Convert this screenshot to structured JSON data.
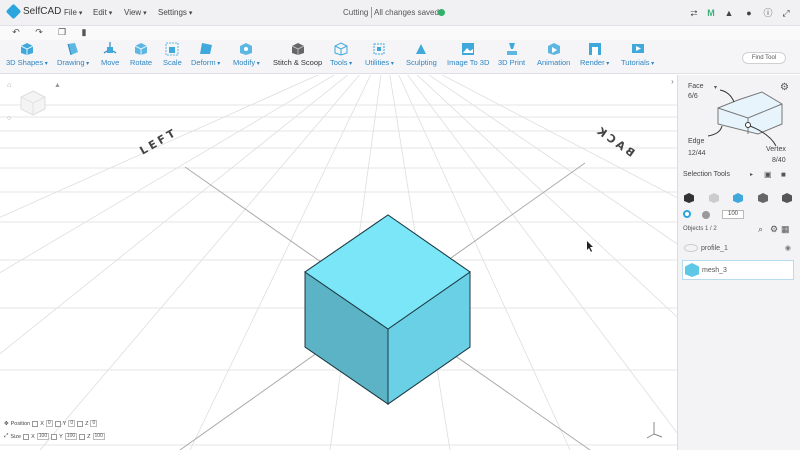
{
  "app": {
    "logo_text": "SelfCAD"
  },
  "menus": [
    "File",
    "Edit",
    "View",
    "Settings"
  ],
  "document": {
    "title": "Cutting",
    "status": "All changes saved"
  },
  "top_icons": [
    "share-icon",
    "m-icon",
    "bell-icon",
    "user-icon",
    "help-icon",
    "fullscreen-icon"
  ],
  "quick_icons": [
    "undo-icon",
    "redo-icon",
    "copy-icon",
    "paste-icon"
  ],
  "toolbar": {
    "tools": [
      {
        "label": "3D Shapes",
        "dropdown": true
      },
      {
        "label": "Drawing",
        "dropdown": true
      },
      {
        "label": "Move",
        "dropdown": false
      },
      {
        "label": "Rotate",
        "dropdown": false
      },
      {
        "label": "Scale",
        "dropdown": false
      },
      {
        "label": "Deform",
        "dropdown": true
      },
      {
        "label": "Modify",
        "dropdown": true
      },
      {
        "label": "Stitch & Scoop",
        "dropdown": false
      },
      {
        "label": "Tools",
        "dropdown": true
      },
      {
        "label": "Utilities",
        "dropdown": true
      },
      {
        "label": "Sculpting",
        "dropdown": false
      },
      {
        "label": "Image To 3D",
        "dropdown": false
      },
      {
        "label": "3D Print",
        "dropdown": false
      },
      {
        "label": "Animation",
        "dropdown": false
      },
      {
        "label": "Render",
        "dropdown": true
      },
      {
        "label": "Tutorials",
        "dropdown": true
      }
    ],
    "find_tool_placeholder": "Find Tool"
  },
  "viewport": {
    "labels": {
      "left": "LEFT",
      "back": "BACK"
    },
    "cube_color": "#77e3f5",
    "transform": {
      "position_label": "Position",
      "size_label": "Size",
      "position": {
        "x": "0",
        "y": "0",
        "z": "0"
      },
      "size": {
        "x": "100",
        "y": "100",
        "z": "100"
      }
    }
  },
  "panel": {
    "face_label": "Face",
    "face_count": "6/6",
    "edge_label": "Edge",
    "edge_count": "12/44",
    "vertex_label": "Vertex",
    "vertex_count": "8/40",
    "selection_tools_label": "Selection Tools",
    "brush_size": "100",
    "objects_label": "Objects 1 / 2",
    "objects": [
      {
        "name": "profile_1",
        "selected": false
      },
      {
        "name": "mesh_3",
        "selected": true
      }
    ]
  },
  "colors": {
    "accent": "#2aa5de",
    "cube_face": "#77e3f5",
    "saved": "#2fb36b"
  }
}
